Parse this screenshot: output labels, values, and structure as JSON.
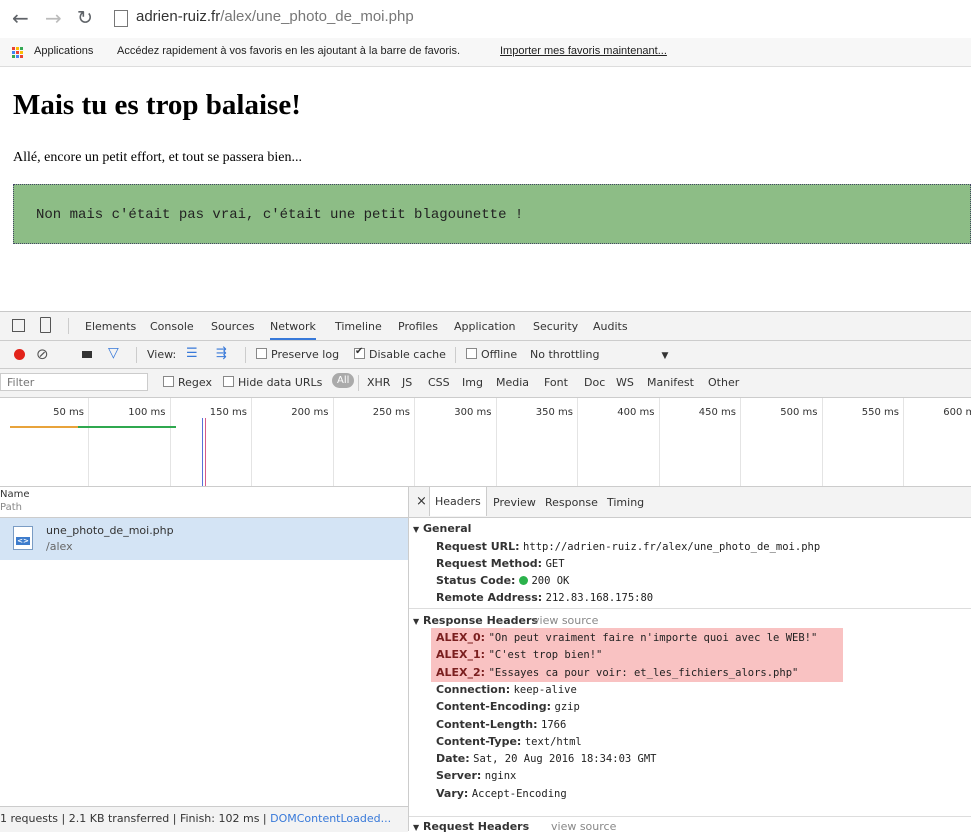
{
  "browser": {
    "url_host": "adrien-ruiz.fr",
    "url_path": "/alex/une_photo_de_moi.php",
    "bookmarks": {
      "apps_label": "Applications",
      "hint": "Accédez rapidement à vos favoris en les ajoutant à la barre de favoris.",
      "import_link": "Importer mes favoris maintenant..."
    }
  },
  "page": {
    "heading": "Mais tu es trop balaise!",
    "paragraph": "Allé, encore un petit effort, et tout se passera bien...",
    "box_text": "Non mais c'était pas vrai, c'était une petit blagounette !",
    "box_color": "#8dbd86"
  },
  "devtools": {
    "tabs": [
      "Elements",
      "Console",
      "Sources",
      "Network",
      "Timeline",
      "Profiles",
      "Application",
      "Security",
      "Audits"
    ],
    "active_tab": "Network",
    "toolbar": {
      "view_label": "View:",
      "preserve_log": "Preserve log",
      "disable_cache": "Disable cache",
      "offline": "Offline",
      "throttling": "No throttling"
    },
    "filter": {
      "placeholder": "Filter",
      "regex": "Regex",
      "hide_data_urls": "Hide data URLs",
      "types": [
        "All",
        "XHR",
        "JS",
        "CSS",
        "Img",
        "Media",
        "Font",
        "Doc",
        "WS",
        "Manifest",
        "Other"
      ]
    },
    "timeline_ticks": [
      "50 ms",
      "100 ms",
      "150 ms",
      "200 ms",
      "250 ms",
      "300 ms",
      "350 ms",
      "400 ms",
      "450 ms",
      "500 ms",
      "550 ms",
      "600 ms"
    ],
    "request_list": {
      "col_name": "Name",
      "col_path": "Path",
      "rows": [
        {
          "name": "une_photo_de_moi.php",
          "path": "/alex"
        }
      ],
      "status_text": "1 requests | 2.1 KB transferred | Finish: 102 ms | ",
      "status_link": "DOMContentLoaded..."
    },
    "details": {
      "close": "×",
      "tabs": [
        "Headers",
        "Preview",
        "Response",
        "Timing"
      ],
      "general_title": "General",
      "general": [
        {
          "k": "Request URL:",
          "v": "http://adrien-ruiz.fr/alex/une_photo_de_moi.php"
        },
        {
          "k": "Request Method:",
          "v": "GET"
        },
        {
          "k": "Status Code:",
          "v": "200 OK"
        },
        {
          "k": "Remote Address:",
          "v": "212.83.168.175:80"
        }
      ],
      "response_title": "Response Headers",
      "view_source": "view source",
      "response": [
        {
          "k": "ALEX_0:",
          "v": "\"On peut vraiment faire n'importe quoi avec le WEB!\""
        },
        {
          "k": "ALEX_1:",
          "v": "\"C'est trop bien!\""
        },
        {
          "k": "ALEX_2:",
          "v": "\"Essayes ca pour voir: et_les_fichiers_alors.php\""
        },
        {
          "k": "Connection:",
          "v": "keep-alive"
        },
        {
          "k": "Content-Encoding:",
          "v": "gzip"
        },
        {
          "k": "Content-Length:",
          "v": "1766"
        },
        {
          "k": "Content-Type:",
          "v": "text/html"
        },
        {
          "k": "Date:",
          "v": "Sat, 20 Aug 2016 18:34:03 GMT"
        },
        {
          "k": "Server:",
          "v": "nginx"
        },
        {
          "k": "Vary:",
          "v": "Accept-Encoding"
        }
      ],
      "request_title": "Request Headers"
    }
  }
}
